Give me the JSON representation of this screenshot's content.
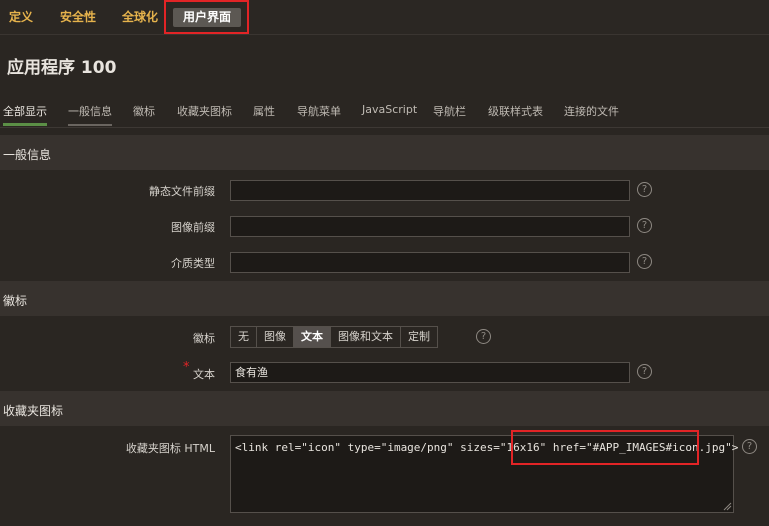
{
  "top_tabs": [
    "定义",
    "安全性",
    "全球化",
    "用户界面"
  ],
  "app_title": "应用程序 100",
  "sub_tabs": [
    "全部显示",
    "一般信息",
    "徽标",
    "收藏夹图标",
    "属性",
    "导航菜单",
    "JavaScript",
    "导航栏",
    "级联样式表",
    "连接的文件"
  ],
  "sections": {
    "general": {
      "title": "一般信息",
      "static_file_prefix_label": "静态文件前缀",
      "static_file_prefix_value": "",
      "image_prefix_label": "图像前缀",
      "image_prefix_value": "",
      "media_type_label": "介质类型",
      "media_type_value": ""
    },
    "logo": {
      "title": "徽标",
      "logo_label": "徽标",
      "options": [
        "无",
        "图像",
        "文本",
        "图像和文本",
        "定制"
      ],
      "selected": "文本",
      "text_label": "文本",
      "text_value": "食有渔"
    },
    "favicon": {
      "title": "收藏夹图标",
      "html_label": "收藏夹图标 HTML",
      "html_value": "<link rel=\"icon\" type=\"image/png\" sizes=\"16x16\" href=\"#APP_IMAGES#icon.jpg\">"
    }
  },
  "help_glyph": "?",
  "required_mark": "*",
  "colors": {
    "background": "#2a2622",
    "section_header": "#37322e",
    "tab_text": "#e6b34c",
    "active_underline": "#5b8f46",
    "highlight_box": "#e22426"
  }
}
